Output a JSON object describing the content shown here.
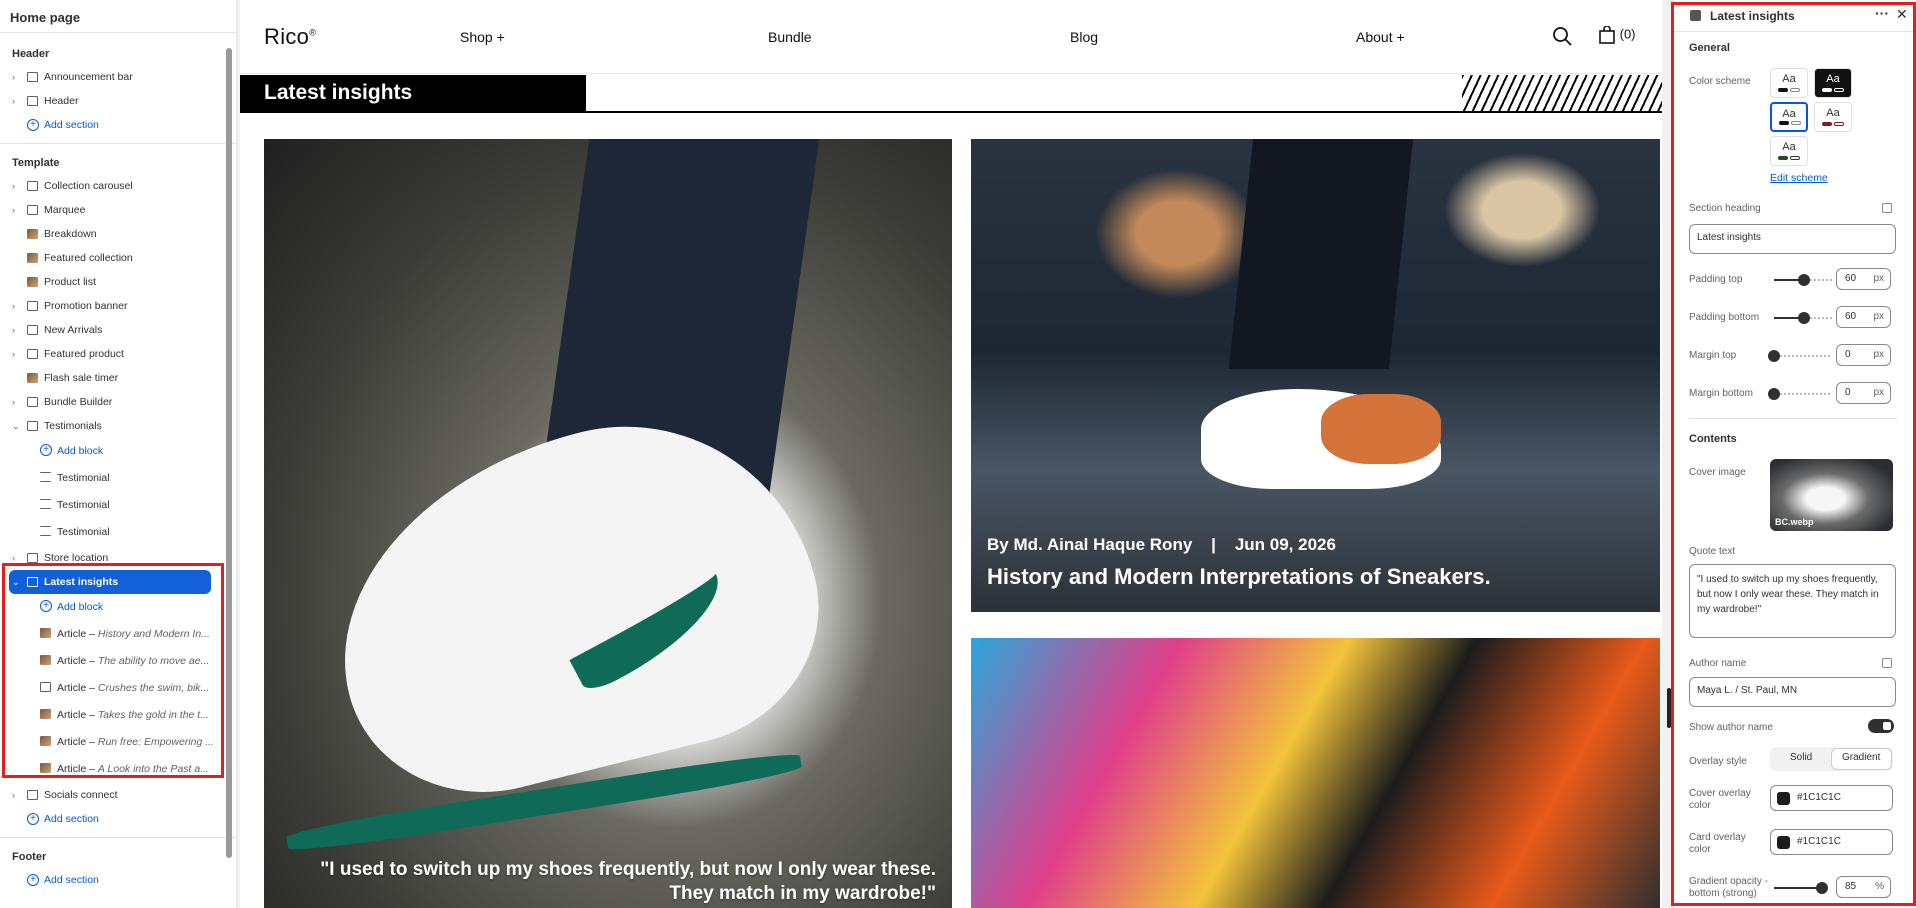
{
  "left_panel": {
    "title": "Home page",
    "header_group": "Header",
    "header_items": [
      "Announcement bar",
      "Header"
    ],
    "add_section": "Add section",
    "template_group": "Template",
    "template_items": [
      "Collection carousel",
      "Marquee",
      "Breakdown",
      "Featured collection",
      "Product list",
      "Promotion banner",
      "New Arrivals",
      "Featured product",
      "Flash sale timer",
      "Bundle Builder",
      "Testimonials"
    ],
    "add_block": "Add block",
    "testimonial_blocks": [
      "Testimonial",
      "Testimonial",
      "Testimonial"
    ],
    "store_location": "Store location",
    "selected_section": "Latest insights",
    "articles": [
      {
        "prefix": "Article – ",
        "title": "History and Modern In..."
      },
      {
        "prefix": "Article – ",
        "title": "The ability to move ae..."
      },
      {
        "prefix": "Article – ",
        "title": "Crushes the swim, bik..."
      },
      {
        "prefix": "Article – ",
        "title": "Takes the gold in the t..."
      },
      {
        "prefix": "Article – ",
        "title": "Run free: Empowering ..."
      },
      {
        "prefix": "Article – ",
        "title": "A Look into the Past a..."
      }
    ],
    "socials": "Socials connect",
    "footer_group": "Footer"
  },
  "preview": {
    "logo": "Rico",
    "logo_mark": "®",
    "nav": [
      "Shop +",
      "Bundle",
      "Blog",
      "About +"
    ],
    "cart_count": "(0)",
    "section_heading": "Latest insights",
    "card1_quote_line1": "\"I used to switch up my shoes frequently, but now I only wear these.",
    "card1_quote_line2": "They match in my wardrobe!\"",
    "card2_meta": "By Md. Ainal Haque Rony    |    Jun 09, 2026",
    "card2_title": "History and Modern Interpretations of Sneakers."
  },
  "right_panel": {
    "title": "Latest insights",
    "general": "General",
    "color_scheme": "Color scheme",
    "swatch_label": "Aa",
    "edit_scheme": "Edit scheme",
    "section_heading_label": "Section heading",
    "section_heading_value": "Latest insights",
    "padding_top_label": "Padding top",
    "padding_top": "60",
    "padding_bottom_label": "Padding bottom",
    "padding_bottom": "60",
    "margin_top_label": "Margin top",
    "margin_top": "0",
    "margin_bottom_label": "Margin bottom",
    "margin_bottom": "0",
    "unit_px": "px",
    "contents": "Contents",
    "cover_image_label": "Cover image",
    "cover_image_file": "BC.webp",
    "quote_text_label": "Quote text",
    "quote_text_value": "\"I used to switch up my shoes frequently, but now I only wear these. They match in my wardrobe!\"",
    "author_name_label": "Author name",
    "author_name_value": "Maya L. / St. Paul, MN",
    "show_author_label": "Show author name",
    "show_author": true,
    "overlay_style_label": "Overlay style",
    "overlay_options": [
      "Solid",
      "Gradient"
    ],
    "overlay_selected": "Gradient",
    "cover_overlay_label": "Cover overlay color",
    "cover_overlay_value": "#1C1C1C",
    "card_overlay_label": "Card overlay color",
    "card_overlay_value": "#1C1C1C",
    "gradient_opacity_label": "Gradient opacity - bottom (strong)",
    "gradient_opacity": "85",
    "unit_pct": "%"
  },
  "colors": {
    "accent": "#005bd3",
    "selected": "#1260d8",
    "highlight": "#e02020",
    "overlay": "#1C1C1C"
  }
}
